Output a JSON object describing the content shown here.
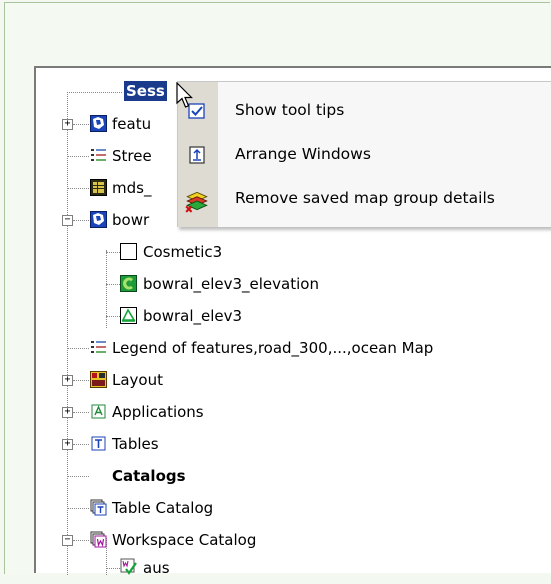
{
  "tree": {
    "session_label": "Sess",
    "items": [
      {
        "label": "featu"
      },
      {
        "label": "Stree"
      },
      {
        "label": "mds_"
      },
      {
        "label": "bowr"
      },
      {
        "label": "Cosmetic3"
      },
      {
        "label": "bowral_elev3_elevation"
      },
      {
        "label": "bowral_elev3"
      },
      {
        "label": "Legend of features,road_300,...,ocean Map"
      },
      {
        "label": "Layout"
      },
      {
        "label": "Applications"
      },
      {
        "label": "Tables"
      },
      {
        "label": "Catalogs"
      },
      {
        "label": "Table Catalog"
      },
      {
        "label": "Workspace Catalog"
      },
      {
        "label": "aus"
      }
    ]
  },
  "context_menu": {
    "items": [
      {
        "label": "Show tool tips",
        "icon": "checkbox-checked-icon"
      },
      {
        "label": "Arrange Windows",
        "icon": "arrange-windows-icon"
      },
      {
        "label": "Remove saved map group details",
        "icon": "remove-layers-icon"
      }
    ]
  }
}
